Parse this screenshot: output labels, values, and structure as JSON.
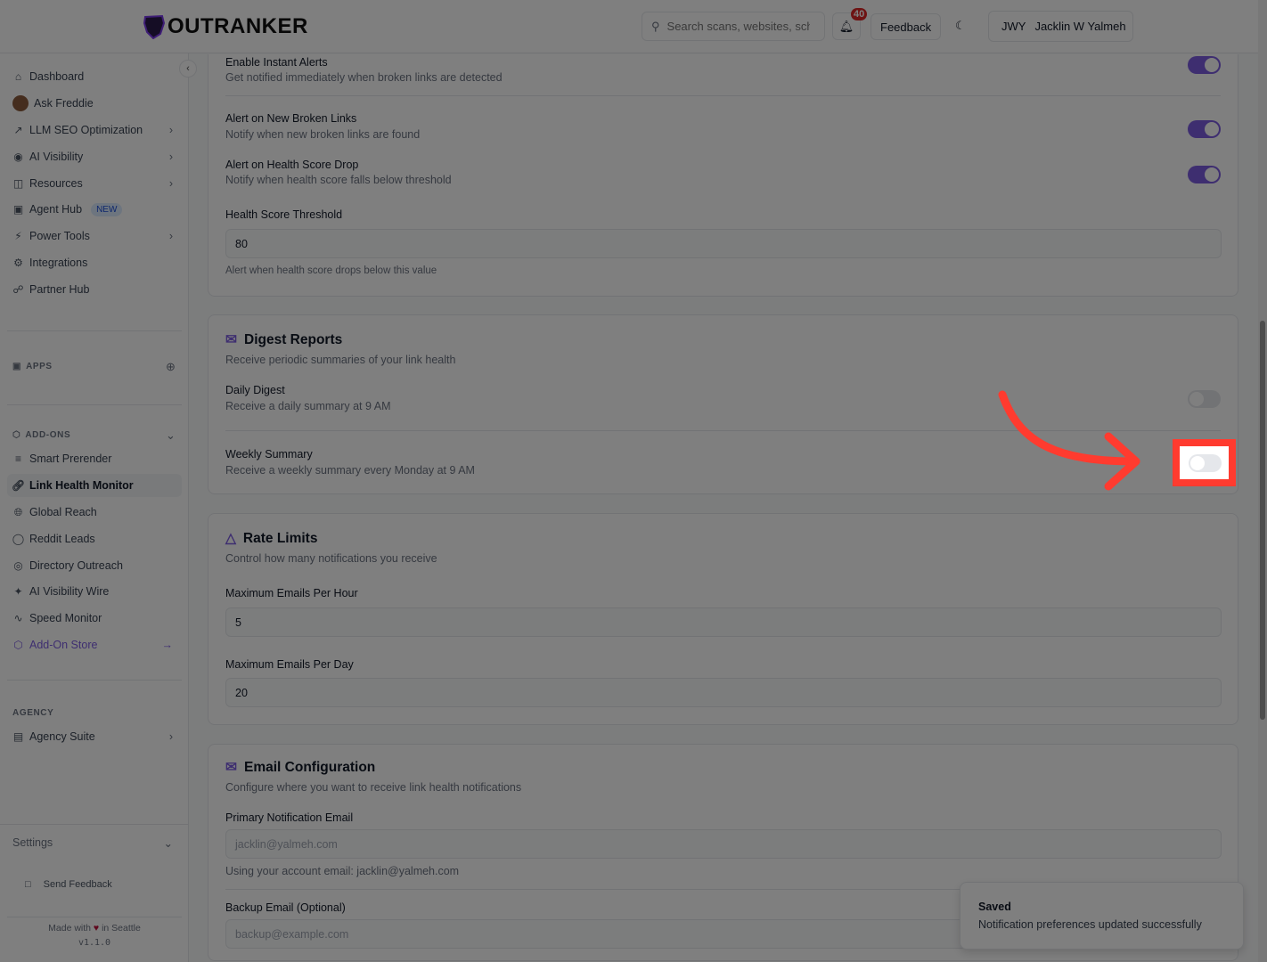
{
  "header": {
    "logo": "OUTRANKER",
    "search_placeholder": "Search scans, websites, schedules",
    "notification_count": "40",
    "feedback": "Feedback",
    "user_initials": "JWY",
    "user_name": "Jacklin W Yalmeh"
  },
  "sidebar": {
    "items": [
      {
        "label": "Dashboard"
      },
      {
        "label": "Ask Freddie"
      },
      {
        "label": "LLM SEO Optimization"
      },
      {
        "label": "AI Visibility"
      },
      {
        "label": "Resources"
      },
      {
        "label": "Agent Hub",
        "badge": "NEW"
      },
      {
        "label": "Power Tools"
      },
      {
        "label": "Integrations"
      },
      {
        "label": "Partner Hub"
      }
    ],
    "apps_label": "APPS",
    "addons_label": "ADD-ONS",
    "addons": [
      {
        "label": "Smart Prerender"
      },
      {
        "label": "Link Health Monitor"
      },
      {
        "label": "Global Reach"
      },
      {
        "label": "Reddit Leads"
      },
      {
        "label": "Directory Outreach"
      },
      {
        "label": "AI Visibility Wire"
      },
      {
        "label": "Speed Monitor"
      },
      {
        "label": "Add-On Store"
      }
    ],
    "agency_label": "AGENCY",
    "agency_suite": "Agency Suite",
    "settings": "Settings",
    "send_feedback": "Send Feedback",
    "made_with": "Made with",
    "in_seattle": "in Seattle",
    "version": "v1.1.0"
  },
  "alerts": {
    "instant_title": "Enable Instant Alerts",
    "instant_desc": "Get notified immediately when broken links are detected",
    "instant_on": true,
    "new_broken_title": "Alert on New Broken Links",
    "new_broken_desc": "Notify when new broken links are found",
    "new_broken_on": true,
    "score_drop_title": "Alert on Health Score Drop",
    "score_drop_desc": "Notify when health score falls below threshold",
    "score_drop_on": true,
    "threshold_label": "Health Score Threshold",
    "threshold_value": "80",
    "threshold_help": "Alert when health score drops below this value"
  },
  "digest": {
    "title": "Digest Reports",
    "subtitle": "Receive periodic summaries of your link health",
    "daily_title": "Daily Digest",
    "daily_desc": "Receive a daily summary at 9 AM",
    "daily_on": false,
    "weekly_title": "Weekly Summary",
    "weekly_desc": "Receive a weekly summary every Monday at 9 AM",
    "weekly_on": false
  },
  "rate": {
    "title": "Rate Limits",
    "subtitle": "Control how many notifications you receive",
    "per_hour_label": "Maximum Emails Per Hour",
    "per_hour": "5",
    "per_day_label": "Maximum Emails Per Day",
    "per_day": "20"
  },
  "email": {
    "title": "Email Configuration",
    "subtitle": "Configure where you want to receive link health notifications",
    "primary_label": "Primary Notification Email",
    "primary_placeholder": "jacklin@yalmeh.com",
    "primary_help": "Using your account email: jacklin@yalmeh.com",
    "backup_label": "Backup Email (Optional)",
    "backup_placeholder": "backup@example.com"
  },
  "toast": {
    "title": "Saved",
    "message": "Notification preferences updated successfully"
  },
  "colors": {
    "accent": "#7c5ce0",
    "annotation": "#ff3b2f"
  }
}
